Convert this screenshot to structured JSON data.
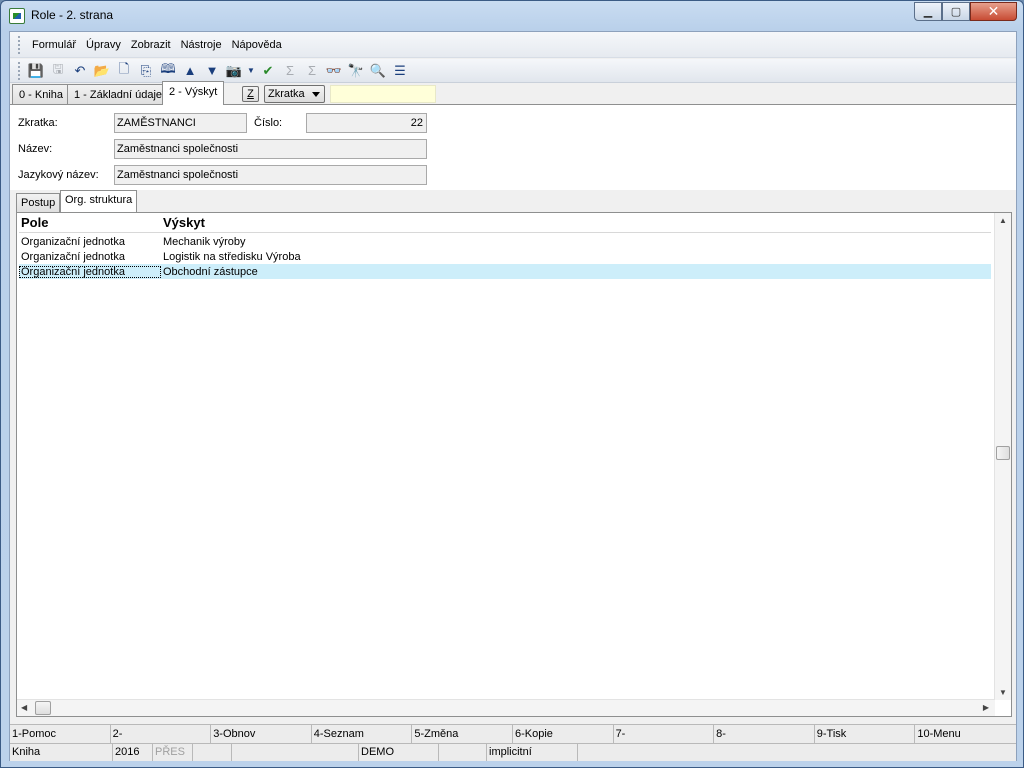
{
  "window": {
    "title": "Role - 2. strana"
  },
  "menu": [
    "Formulář",
    "Úpravy",
    "Zobrazit",
    "Nástroje",
    "Nápověda"
  ],
  "tabs": [
    {
      "label": "0 - Kniha"
    },
    {
      "label": "1 - Základní údaje"
    },
    {
      "label": "2 - Výskyt"
    }
  ],
  "sort": {
    "z_label": "Z",
    "combo_value": "Zkratka",
    "search_value": ""
  },
  "form": {
    "zkratka": {
      "label": "Zkratka:",
      "value": "ZAMĚSTNANCI"
    },
    "cislo": {
      "label": "Číslo:",
      "value": "22"
    },
    "nazev": {
      "label": "Název:",
      "value": "Zaměstnanci společnosti"
    },
    "jazykovy": {
      "label": "Jazykový název:",
      "value": "Zaměstnanci společnosti"
    }
  },
  "subtabs": [
    {
      "label": "Postup"
    },
    {
      "label": "Org. struktura"
    }
  ],
  "grid": {
    "columns": [
      "Pole",
      "Výskyt"
    ],
    "rows": [
      [
        "Organizační jednotka",
        "Mechanik výroby"
      ],
      [
        "Organizační jednotka",
        "Logistik na středisku Výroba"
      ],
      [
        "Organizační jednotka",
        "Obchodní zástupce"
      ]
    ]
  },
  "fkeys": [
    "1-Pomoc",
    "2-",
    "3-Obnov",
    "4-Seznam",
    "5-Změna",
    "6-Kopie",
    "7-",
    "8-",
    "9-Tisk",
    "10-Menu"
  ],
  "status": {
    "kniha": "Kniha",
    "year": "2016",
    "mode": "PŘES",
    "db": "DEMO",
    "profile": "implicitní"
  }
}
